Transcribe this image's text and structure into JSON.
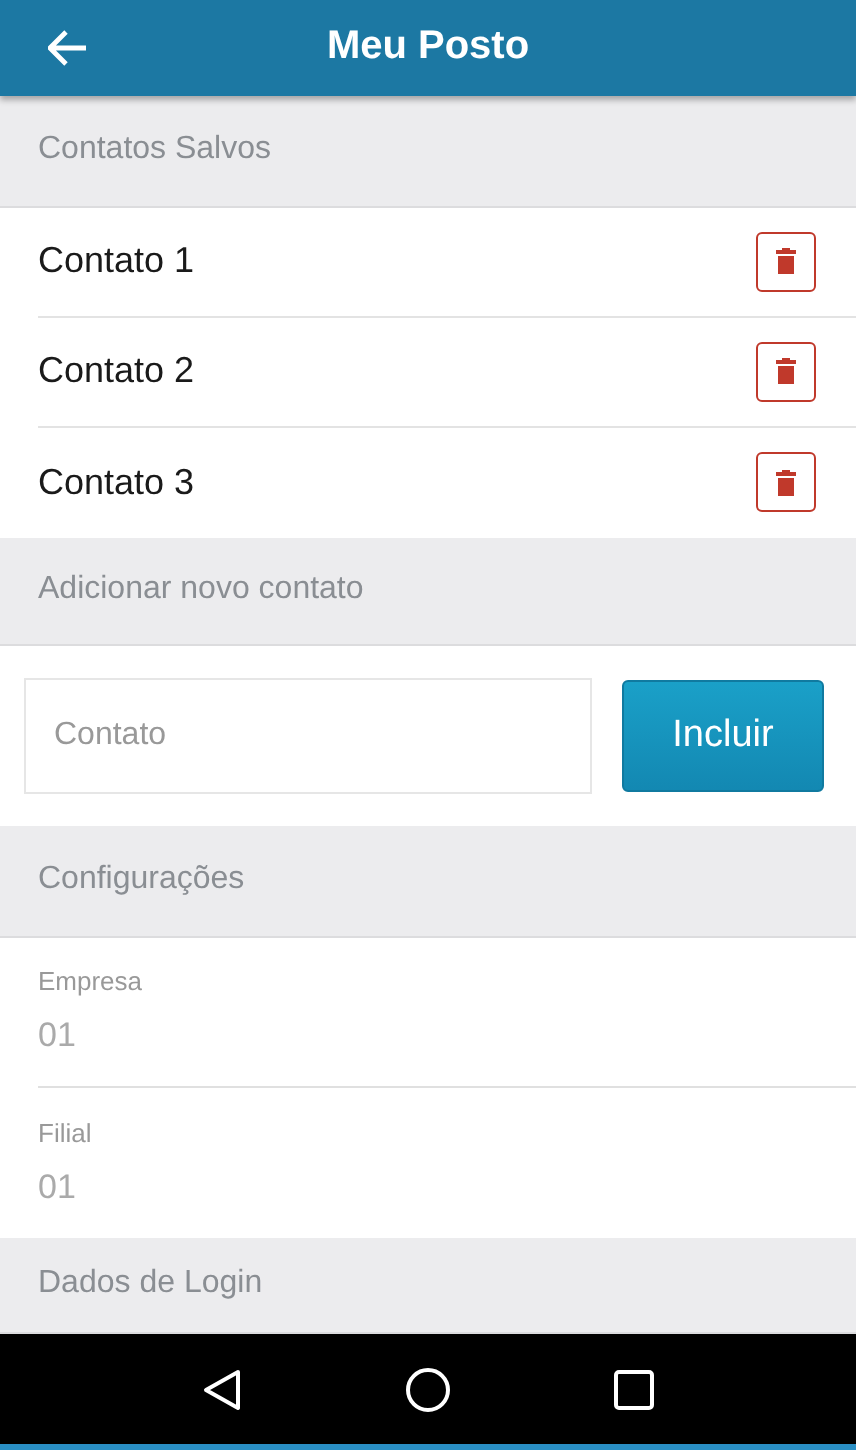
{
  "app_bar": {
    "title": "Meu Posto"
  },
  "saved_contacts": {
    "heading": "Contatos Salvos",
    "items": [
      {
        "name": "Contato 1"
      },
      {
        "name": "Contato 2"
      },
      {
        "name": "Contato 3"
      }
    ]
  },
  "new_contact": {
    "heading": "Adicionar novo contato",
    "placeholder": "Contato",
    "button": "Incluir"
  },
  "settings": {
    "heading": "Configurações",
    "fields": [
      {
        "label": "Empresa",
        "value": "01"
      },
      {
        "label": "Filial",
        "value": "01"
      }
    ]
  },
  "login": {
    "heading": "Dados de Login"
  }
}
